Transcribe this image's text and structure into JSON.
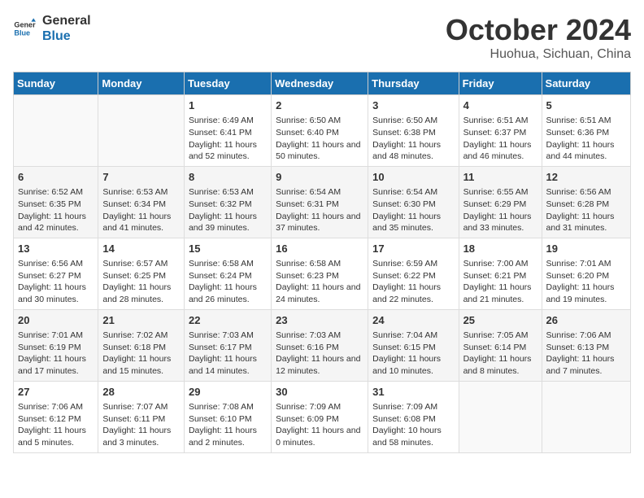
{
  "logo": {
    "line1": "General",
    "line2": "Blue"
  },
  "title": "October 2024",
  "location": "Huohua, Sichuan, China",
  "days_header": [
    "Sunday",
    "Monday",
    "Tuesday",
    "Wednesday",
    "Thursday",
    "Friday",
    "Saturday"
  ],
  "weeks": [
    [
      {
        "day": "",
        "sunrise": "",
        "sunset": "",
        "daylight": ""
      },
      {
        "day": "",
        "sunrise": "",
        "sunset": "",
        "daylight": ""
      },
      {
        "day": "1",
        "sunrise": "Sunrise: 6:49 AM",
        "sunset": "Sunset: 6:41 PM",
        "daylight": "Daylight: 11 hours and 52 minutes."
      },
      {
        "day": "2",
        "sunrise": "Sunrise: 6:50 AM",
        "sunset": "Sunset: 6:40 PM",
        "daylight": "Daylight: 11 hours and 50 minutes."
      },
      {
        "day": "3",
        "sunrise": "Sunrise: 6:50 AM",
        "sunset": "Sunset: 6:38 PM",
        "daylight": "Daylight: 11 hours and 48 minutes."
      },
      {
        "day": "4",
        "sunrise": "Sunrise: 6:51 AM",
        "sunset": "Sunset: 6:37 PM",
        "daylight": "Daylight: 11 hours and 46 minutes."
      },
      {
        "day": "5",
        "sunrise": "Sunrise: 6:51 AM",
        "sunset": "Sunset: 6:36 PM",
        "daylight": "Daylight: 11 hours and 44 minutes."
      }
    ],
    [
      {
        "day": "6",
        "sunrise": "Sunrise: 6:52 AM",
        "sunset": "Sunset: 6:35 PM",
        "daylight": "Daylight: 11 hours and 42 minutes."
      },
      {
        "day": "7",
        "sunrise": "Sunrise: 6:53 AM",
        "sunset": "Sunset: 6:34 PM",
        "daylight": "Daylight: 11 hours and 41 minutes."
      },
      {
        "day": "8",
        "sunrise": "Sunrise: 6:53 AM",
        "sunset": "Sunset: 6:32 PM",
        "daylight": "Daylight: 11 hours and 39 minutes."
      },
      {
        "day": "9",
        "sunrise": "Sunrise: 6:54 AM",
        "sunset": "Sunset: 6:31 PM",
        "daylight": "Daylight: 11 hours and 37 minutes."
      },
      {
        "day": "10",
        "sunrise": "Sunrise: 6:54 AM",
        "sunset": "Sunset: 6:30 PM",
        "daylight": "Daylight: 11 hours and 35 minutes."
      },
      {
        "day": "11",
        "sunrise": "Sunrise: 6:55 AM",
        "sunset": "Sunset: 6:29 PM",
        "daylight": "Daylight: 11 hours and 33 minutes."
      },
      {
        "day": "12",
        "sunrise": "Sunrise: 6:56 AM",
        "sunset": "Sunset: 6:28 PM",
        "daylight": "Daylight: 11 hours and 31 minutes."
      }
    ],
    [
      {
        "day": "13",
        "sunrise": "Sunrise: 6:56 AM",
        "sunset": "Sunset: 6:27 PM",
        "daylight": "Daylight: 11 hours and 30 minutes."
      },
      {
        "day": "14",
        "sunrise": "Sunrise: 6:57 AM",
        "sunset": "Sunset: 6:25 PM",
        "daylight": "Daylight: 11 hours and 28 minutes."
      },
      {
        "day": "15",
        "sunrise": "Sunrise: 6:58 AM",
        "sunset": "Sunset: 6:24 PM",
        "daylight": "Daylight: 11 hours and 26 minutes."
      },
      {
        "day": "16",
        "sunrise": "Sunrise: 6:58 AM",
        "sunset": "Sunset: 6:23 PM",
        "daylight": "Daylight: 11 hours and 24 minutes."
      },
      {
        "day": "17",
        "sunrise": "Sunrise: 6:59 AM",
        "sunset": "Sunset: 6:22 PM",
        "daylight": "Daylight: 11 hours and 22 minutes."
      },
      {
        "day": "18",
        "sunrise": "Sunrise: 7:00 AM",
        "sunset": "Sunset: 6:21 PM",
        "daylight": "Daylight: 11 hours and 21 minutes."
      },
      {
        "day": "19",
        "sunrise": "Sunrise: 7:01 AM",
        "sunset": "Sunset: 6:20 PM",
        "daylight": "Daylight: 11 hours and 19 minutes."
      }
    ],
    [
      {
        "day": "20",
        "sunrise": "Sunrise: 7:01 AM",
        "sunset": "Sunset: 6:19 PM",
        "daylight": "Daylight: 11 hours and 17 minutes."
      },
      {
        "day": "21",
        "sunrise": "Sunrise: 7:02 AM",
        "sunset": "Sunset: 6:18 PM",
        "daylight": "Daylight: 11 hours and 15 minutes."
      },
      {
        "day": "22",
        "sunrise": "Sunrise: 7:03 AM",
        "sunset": "Sunset: 6:17 PM",
        "daylight": "Daylight: 11 hours and 14 minutes."
      },
      {
        "day": "23",
        "sunrise": "Sunrise: 7:03 AM",
        "sunset": "Sunset: 6:16 PM",
        "daylight": "Daylight: 11 hours and 12 minutes."
      },
      {
        "day": "24",
        "sunrise": "Sunrise: 7:04 AM",
        "sunset": "Sunset: 6:15 PM",
        "daylight": "Daylight: 11 hours and 10 minutes."
      },
      {
        "day": "25",
        "sunrise": "Sunrise: 7:05 AM",
        "sunset": "Sunset: 6:14 PM",
        "daylight": "Daylight: 11 hours and 8 minutes."
      },
      {
        "day": "26",
        "sunrise": "Sunrise: 7:06 AM",
        "sunset": "Sunset: 6:13 PM",
        "daylight": "Daylight: 11 hours and 7 minutes."
      }
    ],
    [
      {
        "day": "27",
        "sunrise": "Sunrise: 7:06 AM",
        "sunset": "Sunset: 6:12 PM",
        "daylight": "Daylight: 11 hours and 5 minutes."
      },
      {
        "day": "28",
        "sunrise": "Sunrise: 7:07 AM",
        "sunset": "Sunset: 6:11 PM",
        "daylight": "Daylight: 11 hours and 3 minutes."
      },
      {
        "day": "29",
        "sunrise": "Sunrise: 7:08 AM",
        "sunset": "Sunset: 6:10 PM",
        "daylight": "Daylight: 11 hours and 2 minutes."
      },
      {
        "day": "30",
        "sunrise": "Sunrise: 7:09 AM",
        "sunset": "Sunset: 6:09 PM",
        "daylight": "Daylight: 11 hours and 0 minutes."
      },
      {
        "day": "31",
        "sunrise": "Sunrise: 7:09 AM",
        "sunset": "Sunset: 6:08 PM",
        "daylight": "Daylight: 10 hours and 58 minutes."
      },
      {
        "day": "",
        "sunrise": "",
        "sunset": "",
        "daylight": ""
      },
      {
        "day": "",
        "sunrise": "",
        "sunset": "",
        "daylight": ""
      }
    ]
  ]
}
